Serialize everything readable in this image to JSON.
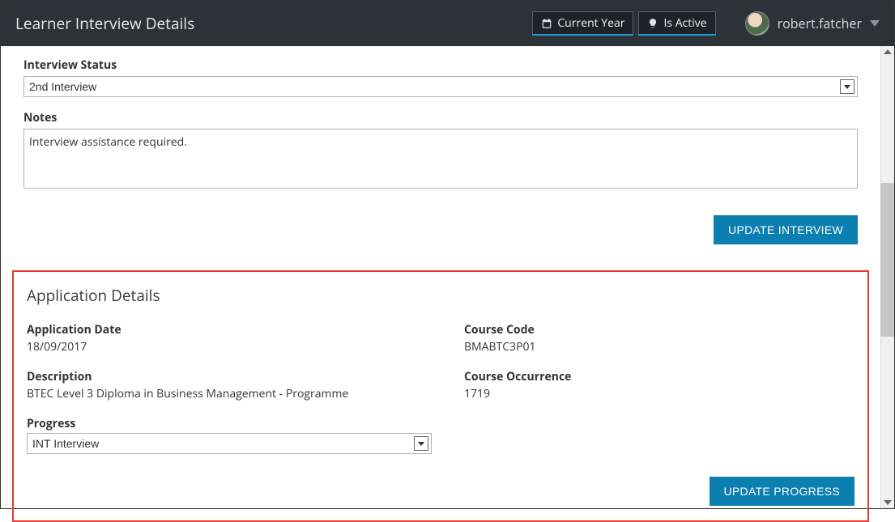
{
  "header": {
    "title": "Learner Interview Details",
    "filters": {
      "currentYear": "Current Year",
      "isActive": "Is Active"
    },
    "username": "robert.fatcher"
  },
  "interview": {
    "statusLabel": "Interview Status",
    "statusValue": "2nd Interview",
    "notesLabel": "Notes",
    "notesValue": "Interview assistance required.",
    "updateButton": "UPDATE INTERVIEW"
  },
  "application": {
    "sectionTitle": "Application Details",
    "fields": {
      "applicationDate": {
        "label": "Application Date",
        "value": "18/09/2017"
      },
      "description": {
        "label": "Description",
        "value": "BTEC Level 3 Diploma in Business Management - Programme"
      },
      "courseCode": {
        "label": "Course Code",
        "value": "BMABTC3P01"
      },
      "courseOccurrence": {
        "label": "Course Occurrence",
        "value": "1719"
      },
      "progress": {
        "label": "Progress",
        "value": "INT Interview"
      }
    },
    "updateButton": "UPDATE PROGRESS"
  }
}
